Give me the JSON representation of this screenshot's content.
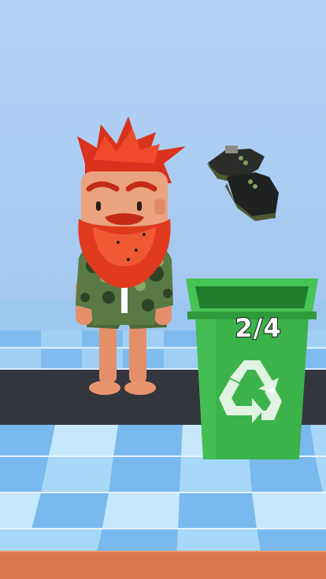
{
  "game": {
    "bin_counter": "2/4",
    "bin_color": "#3bb34a",
    "recycle_icon": "recycle-icon",
    "character": "bearded-man",
    "thrown_item": "boots"
  }
}
